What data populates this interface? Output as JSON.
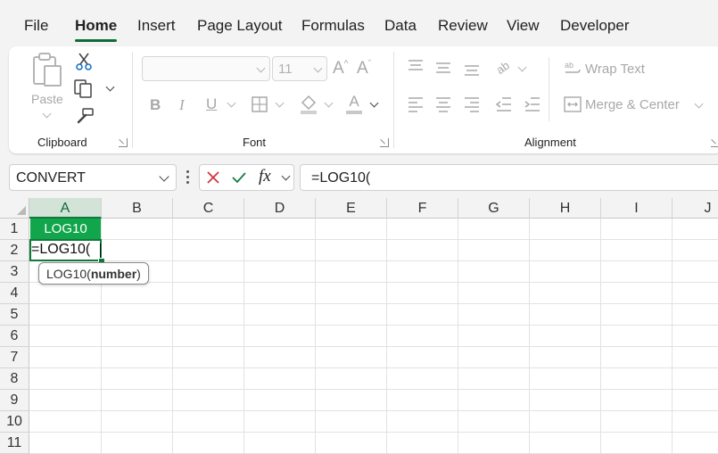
{
  "menu": {
    "tabs": [
      {
        "label": "File"
      },
      {
        "label": "Home",
        "active": true
      },
      {
        "label": "Insert"
      },
      {
        "label": "Page Layout"
      },
      {
        "label": "Formulas"
      },
      {
        "label": "Data"
      },
      {
        "label": "Review"
      },
      {
        "label": "View"
      },
      {
        "label": "Developer"
      }
    ],
    "accent": "#0f6b3a"
  },
  "ribbon": {
    "clipboard": {
      "label": "Clipboard",
      "paste_label": "Paste",
      "icons": [
        "paste-icon",
        "cut-icon",
        "copy-icon",
        "format-painter-icon"
      ]
    },
    "font": {
      "label": "Font",
      "font_name": "",
      "font_size": "11",
      "icons": [
        "increase-font-icon",
        "decrease-font-icon",
        "bold-icon",
        "italic-icon",
        "underline-icon",
        "borders-icon",
        "fill-color-icon",
        "font-color-icon"
      ]
    },
    "alignment": {
      "label": "Alignment",
      "wrap_text": "Wrap Text",
      "merge_center": "Merge & Center",
      "icons": [
        "align-top-icon",
        "align-middle-icon",
        "align-bottom-icon",
        "orientation-icon",
        "align-left-icon",
        "align-center-icon",
        "align-right-icon",
        "decrease-indent-icon",
        "increase-indent-icon"
      ]
    }
  },
  "formula_bar": {
    "name_box": "CONVERT",
    "fx_label": "fx",
    "formula": "=LOG10("
  },
  "grid": {
    "columns": [
      "A",
      "B",
      "C",
      "D",
      "E",
      "F",
      "G",
      "H",
      "I",
      "J"
    ],
    "rows": [
      "1",
      "2",
      "3",
      "4",
      "5",
      "6",
      "7",
      "8",
      "9",
      "10",
      "11"
    ],
    "cells": {
      "A1": "LOG10",
      "A2": "=LOG10("
    },
    "header_fill": "#11a64b"
  },
  "tooltip": {
    "function": "LOG10(",
    "argument": "number",
    "close": ")"
  }
}
